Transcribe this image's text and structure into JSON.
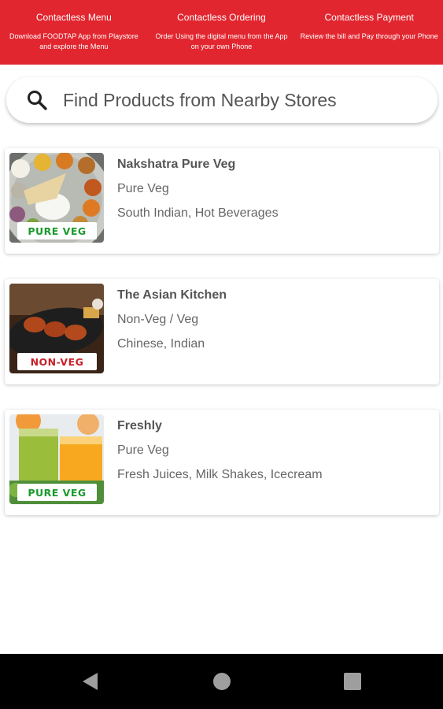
{
  "banner": {
    "items": [
      {
        "title": "Contactless Menu",
        "text": "Download FOODTAP App from Playstore and explore the Menu"
      },
      {
        "title": "Contactless Ordering",
        "text": "Order Using the digital menu from  the App on your own Phone"
      },
      {
        "title": "Contactless Payment",
        "text": "Review the bill and Pay through your Phone"
      }
    ],
    "color": "#e2262f"
  },
  "search": {
    "placeholder": "Find Products from Nearby Stores",
    "icon": "search-icon"
  },
  "stores": [
    {
      "name": "Nakshatra Pure Veg",
      "type": "Pure Veg",
      "cuisine": "South Indian, Hot Beverages",
      "badge": "PURE VEG",
      "badge_color": "#1a9a2c"
    },
    {
      "name": "The Asian Kitchen",
      "type": "Non-Veg / Veg",
      "cuisine": "Chinese, Indian",
      "badge": "NON-VEG",
      "badge_color": "#c8202a"
    },
    {
      "name": "Freshly",
      "type": "Pure Veg",
      "cuisine": "Fresh Juices, Milk Shakes, Icecream",
      "badge": "PURE VEG",
      "badge_color": "#1a9a2c"
    }
  ],
  "navbar": {
    "icons": [
      "back-triangle-icon",
      "home-circle-icon",
      "recents-square-icon"
    ]
  }
}
